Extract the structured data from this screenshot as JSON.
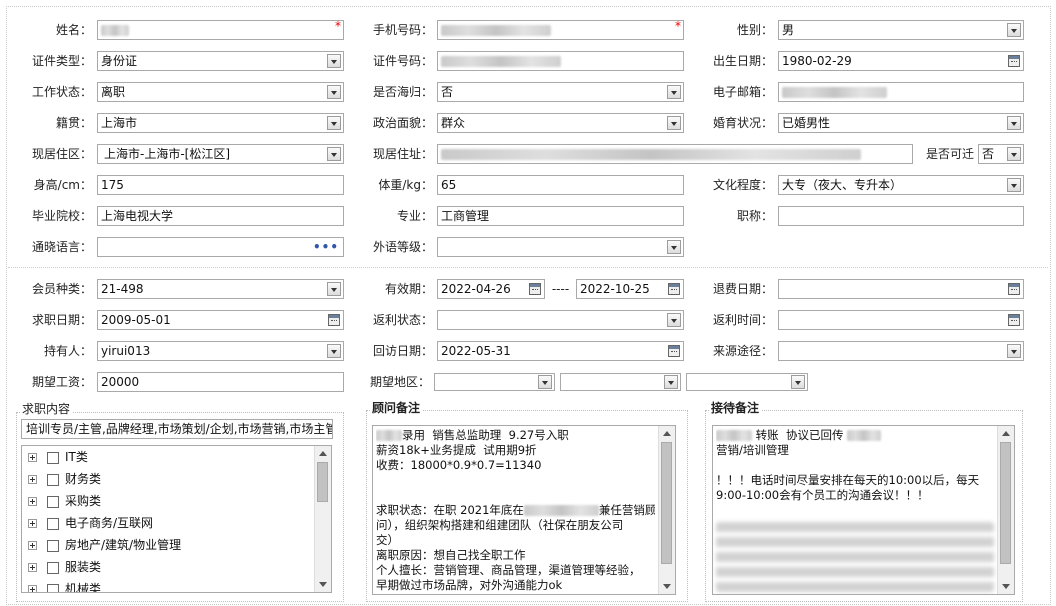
{
  "labels": {
    "name": "姓名：",
    "mobile": "手机号码：",
    "gender": "性别：",
    "id_type": "证件类型：",
    "id_no": "证件号码：",
    "birth": "出生日期：",
    "work_status": "工作状态：",
    "returnee": "是否海归：",
    "email": "电子邮箱：",
    "native": "籍贯：",
    "political": "政治面貌：",
    "marital": "婚育状况：",
    "district": "现居住区：",
    "address": "现居住址：",
    "relocate": "是否可迁",
    "height": "身高/cm：",
    "weight": "体重/kg：",
    "education": "文化程度：",
    "school": "毕业院校：",
    "major": "专业：",
    "title": "职称：",
    "language": "通晓语言：",
    "foreign_level": "外语等级：",
    "member_type": "会员种类：",
    "valid_period": "有效期：",
    "refund_date": "退费日期：",
    "job_date": "求职日期：",
    "rebate_status": "返利状态：",
    "rebate_time": "返利时间：",
    "holder": "持有人：",
    "visit_date": "回访日期：",
    "source": "来源途径：",
    "salary": "期望工资：",
    "region": "期望地区："
  },
  "values": {
    "gender": "男",
    "id_type": "身份证",
    "birth": "1980-02-29",
    "work_status": "离职",
    "returnee": "否",
    "native": "上海市",
    "political": "群众",
    "marital": "已婚男性",
    "district": "上海市-上海市-[松江区]",
    "relocate": "否",
    "height": "175",
    "weight": "65",
    "education": "大专（夜大、专升本）",
    "school": "上海电视大学",
    "major": "工商管理",
    "member_type": "21-498",
    "valid_from": "2022-04-26",
    "valid_sep": "----",
    "valid_to": "2022-10-25",
    "job_date": "2009-05-01",
    "holder": "yirui013",
    "visit_date": "2022-05-31",
    "salary": "20000",
    "language_more": "•••"
  },
  "required_mark": "*",
  "job_content": {
    "title": "求职内容",
    "summary": "培训专员/主管,品牌经理,市场策划/企划,市场营销,市场主管",
    "tree": [
      "IT类",
      "财务类",
      "采购类",
      "电子商务/互联网",
      "房地产/建筑/物业管理",
      "服装类",
      "机械类"
    ]
  },
  "advisor_notes": {
    "title": "顾问备注",
    "lines": [
      "录用  销售总监助理  9.27号入职",
      "薪资18k+业务提成  试用期9折",
      "收费：18000*0.9*0.7=11340",
      "",
      "",
      "求职状态：在职 2021年底在",
      "问），组织架构搭建和组建团队（社保在朋友公司",
      "交）",
      "离职原因：想自己找全职工作",
      "个人擅长：营销管理、商品管理，渠道管理等经验，",
      "早期做过市场品牌，对外沟通能力ok"
    ],
    "line6_suffix": "兼任营销顾"
  },
  "reception_notes": {
    "title": "接待备注",
    "lines": [
      "转账  协议已回传",
      "营销/培训管理",
      "",
      "！！！电话时间尽量安排在每天的10:00以后，每天",
      "9:00-10:00会有个员工的沟通会议！！！"
    ]
  }
}
